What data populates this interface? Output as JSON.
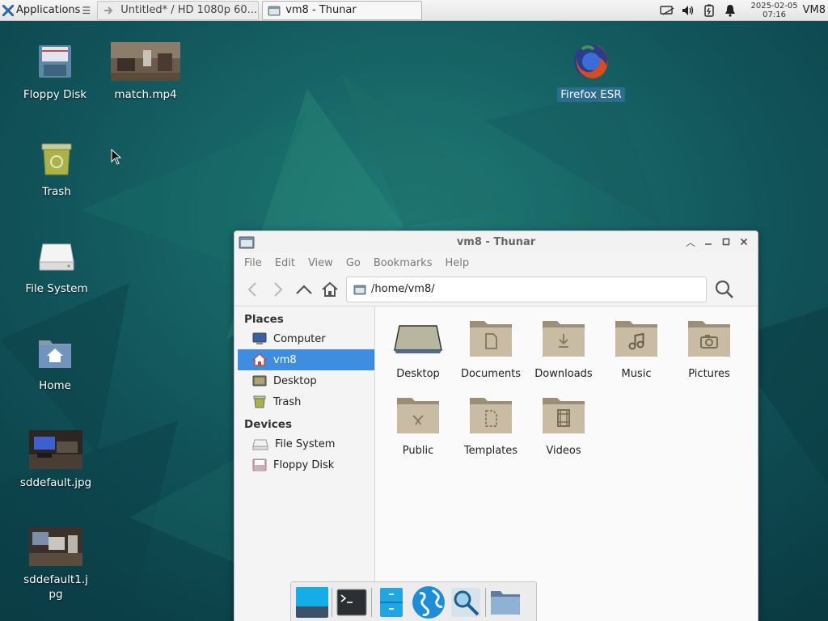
{
  "panel": {
    "applications_label": "Applications",
    "tasks": [
      {
        "label": "Untitled* / HD 1080p 60..."
      },
      {
        "label": "vm8 - Thunar"
      }
    ],
    "clock_date": "2025-02-05",
    "clock_time": "07:16",
    "user": "VM8"
  },
  "desktop": {
    "icons": [
      {
        "label": "Floppy Disk",
        "icon": "floppy-disk-icon"
      },
      {
        "label": "match.mp4",
        "icon": "video-thumbnail"
      },
      {
        "label": "Firefox ESR",
        "icon": "firefox-icon"
      },
      {
        "label": "Trash",
        "icon": "trash-icon"
      },
      {
        "label": "File System",
        "icon": "drive-icon"
      },
      {
        "label": "Home",
        "icon": "home-folder-icon"
      },
      {
        "label": "sddefault.jpg",
        "icon": "image-thumbnail"
      },
      {
        "label": "sddefault1.jpg",
        "icon": "image-thumbnail"
      }
    ]
  },
  "thunar": {
    "title": "vm8 - Thunar",
    "menu": [
      "File",
      "Edit",
      "View",
      "Go",
      "Bookmarks",
      "Help"
    ],
    "location": "/home/vm8/",
    "sidebar": {
      "places_heading": "Places",
      "places": [
        "Computer",
        "vm8",
        "Desktop",
        "Trash"
      ],
      "devices_heading": "Devices",
      "devices": [
        "File System",
        "Floppy Disk"
      ]
    },
    "files": [
      "Desktop",
      "Documents",
      "Downloads",
      "Music",
      "Pictures",
      "Public",
      "Templates",
      "Videos"
    ]
  },
  "colors": {
    "selection": "#3d8ee0",
    "folder": "#b9ab92",
    "wallpaper": "#0e4a4f"
  }
}
